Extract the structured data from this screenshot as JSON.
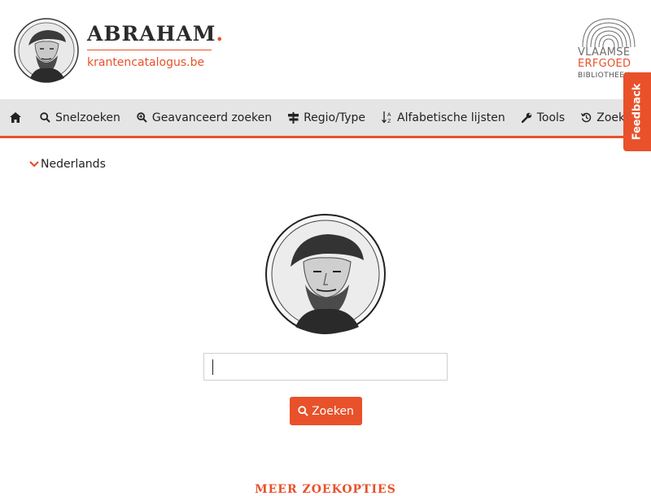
{
  "header": {
    "brand_name": "ABRAHAM",
    "brand_dot": ".",
    "brand_url": "krantencatalogus.be",
    "partner_logo": {
      "line1": "VLAAMSE",
      "line2": "ERFGOED",
      "line3": "BIBLIOTHEEK"
    }
  },
  "nav": {
    "items": [
      {
        "label": "Snelzoeken",
        "icon": "search-icon"
      },
      {
        "label": "Geavanceerd zoeken",
        "icon": "search-plus-icon"
      },
      {
        "label": "Regio/Type",
        "icon": "signpost-icon"
      },
      {
        "label": "Alfabetische lijsten",
        "icon": "sort-alpha-icon"
      },
      {
        "label": "Tools",
        "icon": "wrench-icon"
      },
      {
        "label": "Zoekhistoriek",
        "icon": "history-icon"
      }
    ]
  },
  "feedback": {
    "label": "Feedback"
  },
  "language": {
    "label": "Nederlands"
  },
  "search": {
    "value": "",
    "placeholder": "",
    "button_label": "Zoeken"
  },
  "more_options": {
    "label": "MEER ZOEKOPTIES"
  },
  "colors": {
    "accent": "#e8512a",
    "nav_background": "#e5e5e5",
    "text": "#222222"
  }
}
